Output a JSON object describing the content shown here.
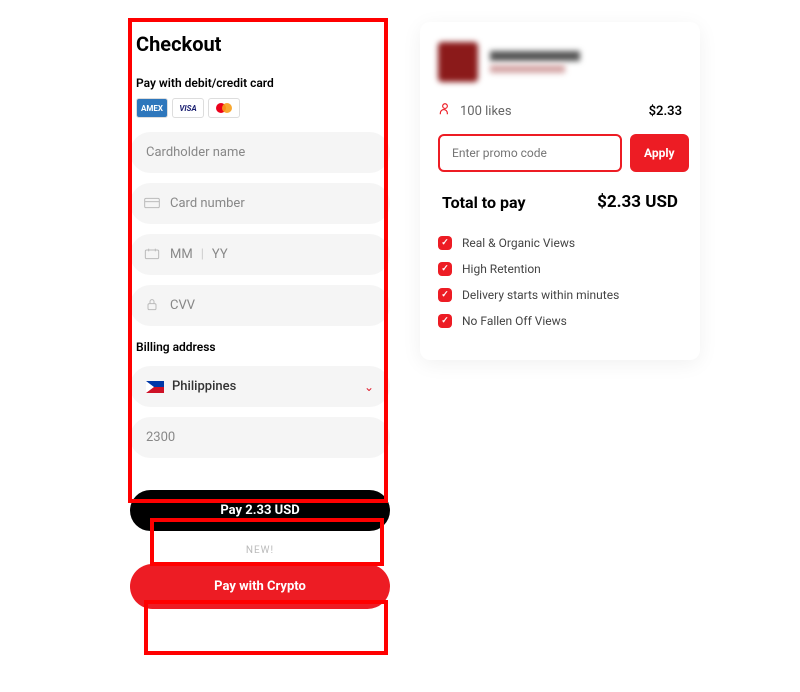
{
  "checkout": {
    "title": "Checkout",
    "pay_with_label": "Pay with debit/credit card",
    "cards": {
      "amex": "AMEX",
      "visa": "VISA"
    },
    "placeholders": {
      "cardholder": "Cardholder name",
      "card_number": "Card number",
      "mm": "MM",
      "yy": "YY",
      "cvv": "CVV"
    },
    "billing_label": "Billing address",
    "country": "Philippines",
    "zip": "2300",
    "pay_btn": "Pay 2.33 USD",
    "new_label": "NEW!",
    "crypto_btn": "Pay with Crypto"
  },
  "summary": {
    "likes_text": "100 likes",
    "likes_price": "$2.33",
    "promo_placeholder": "Enter promo code",
    "apply_btn": "Apply",
    "total_label": "Total to pay",
    "total_amount": "$2.33 USD",
    "features": [
      "Real & Organic Views",
      "High Retention",
      "Delivery starts within minutes",
      "No Fallen Off Views"
    ]
  }
}
